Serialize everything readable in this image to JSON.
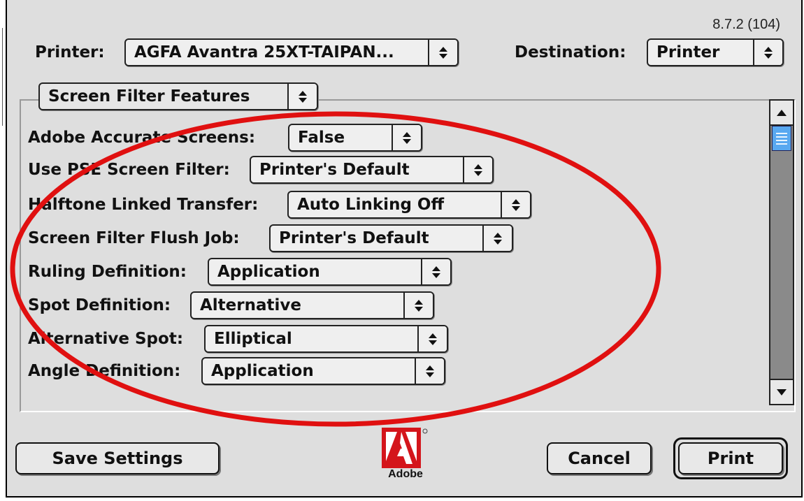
{
  "version": "8.7.2 (104)",
  "printer": {
    "label": "Printer:",
    "value": "AGFA Avantra 25XT-TAIPAN..."
  },
  "destination": {
    "label": "Destination:",
    "value": "Printer"
  },
  "section": {
    "value": "Screen Filter Features"
  },
  "options": [
    {
      "label": "Adobe Accurate Screens:",
      "value": "False"
    },
    {
      "label": "Use PSE Screen Filter:",
      "value": "Printer's Default"
    },
    {
      "label": "Halftone Linked Transfer:",
      "value": "Auto Linking Off"
    },
    {
      "label": "Screen Filter Flush Job:",
      "value": "Printer's Default"
    },
    {
      "label": "Ruling Definition:",
      "value": "Application"
    },
    {
      "label": "Spot Definition:",
      "value": "Alternative"
    },
    {
      "label": "Alternative Spot:",
      "value": "Elliptical"
    },
    {
      "label": "Angle Definition:",
      "value": "Application"
    }
  ],
  "buttons": {
    "save": "Save Settings",
    "cancel": "Cancel",
    "print": "Print"
  },
  "logo": {
    "text": "Adobe",
    "icon": "adobe-logo-icon"
  },
  "colors": {
    "highlight_ellipse": "#e01010",
    "logo_red": "#d4151b",
    "scroll_thumb": "#58a8f0"
  }
}
